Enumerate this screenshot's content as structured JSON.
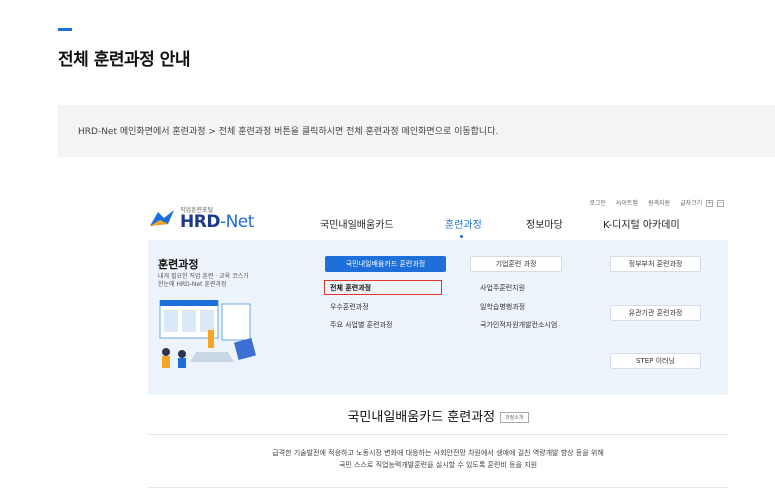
{
  "page": {
    "title": "전체 훈련과정 안내",
    "info": "HRD-Net 메인화면에서 훈련과정 > 전체 훈련과정 버튼을 클릭하시면 전체 훈련과정 메인화면으로 이동합니다.",
    "accent_color": "#1e6fd9"
  },
  "shot": {
    "util": [
      "로그인",
      "사이트맵",
      "원격지원",
      "글자크기"
    ],
    "zoom_plus": "+",
    "zoom_minus": "−",
    "logo": {
      "sub": "직업훈련포털",
      "hrd": "HRD",
      "net": "-Net"
    },
    "gnb": [
      "국민내일배움카드",
      "훈련과정",
      "정보마당",
      "K-디지털 아카데미"
    ],
    "mega": {
      "title": "훈련과정",
      "desc_line1": "내게 필요한 직업 훈련 · 교육 코스가",
      "desc_line2": "한눈에 HRD-Net 훈련과정",
      "col1": {
        "button": "국민내일배움카드 훈련과정",
        "links": [
          "전체 훈련과정",
          "우수훈련과정",
          "주요 사업별 훈련과정"
        ]
      },
      "col2": {
        "button": "기업훈련 과정",
        "links": [
          "사업주훈련지원",
          "일학습병행과정",
          "국가인적자원개발컨소시엄"
        ]
      },
      "col3": {
        "buttons": [
          "정부부처 훈련과정",
          "유관기관 훈련과정",
          "STEP 이러닝"
        ]
      }
    },
    "section": {
      "title": "국민내일배움카드 훈련과정",
      "tag": "과정소개",
      "desc_line1": "급격한 기술발전에 적응하고 노동시장 변화에 대응하는 사회안전망 차원에서 생애에 걸친 역량개발 향상 등을 위해",
      "desc_line2": "국민 스스로 직업능력개발훈련을 실시할 수 있도록 훈련비 등을 지원"
    }
  }
}
